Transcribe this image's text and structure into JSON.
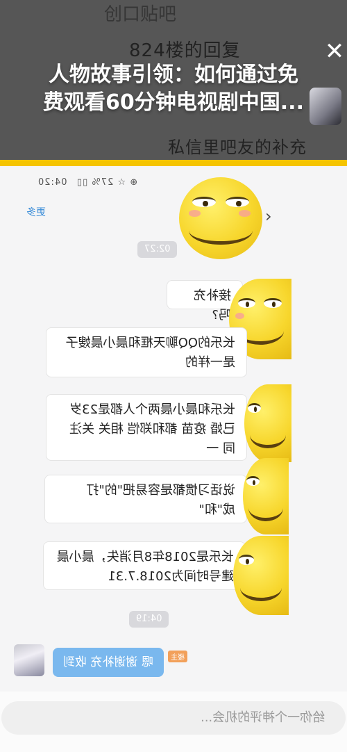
{
  "header": {
    "top_text": "创口贴吧",
    "reply_title": "824楼的回复",
    "private_note": "私信里吧友的补充",
    "overlay_title_line1": "人物故事引领：如何通过免",
    "overlay_title_line2": "费观看60分钟电视剧中国...",
    "close_icon": "close-icon"
  },
  "chat": {
    "status_time": "04:20",
    "status_misc": "⊕ ☆ 27% ▯▯",
    "more_label": "更多",
    "chevron": "›",
    "time_1": "02:27",
    "time_2": "04:19",
    "messages": [
      "接补充吗?",
      "长乐的QQ聊天框和晨小晨嫂子是一样的",
      "长乐和晨小晨两个人都是23岁 已婚 疫苗 都和郑恺 相关 关注同 一",
      "说话习惯都是容易把\"的\"打成\"和\"",
      "长乐是2018年8月消失，晨小晨建号时间为2018.7.31"
    ],
    "reply_bubble": "嗯 谢谢补充 收到",
    "reply_tag": "楼主"
  },
  "comment": {
    "placeholder": "给你一个神评的机会..."
  },
  "colors": {
    "accent_yellow": "#f5c400",
    "reply_blue": "#7ab8ee",
    "link_blue": "#3b8dd8"
  }
}
